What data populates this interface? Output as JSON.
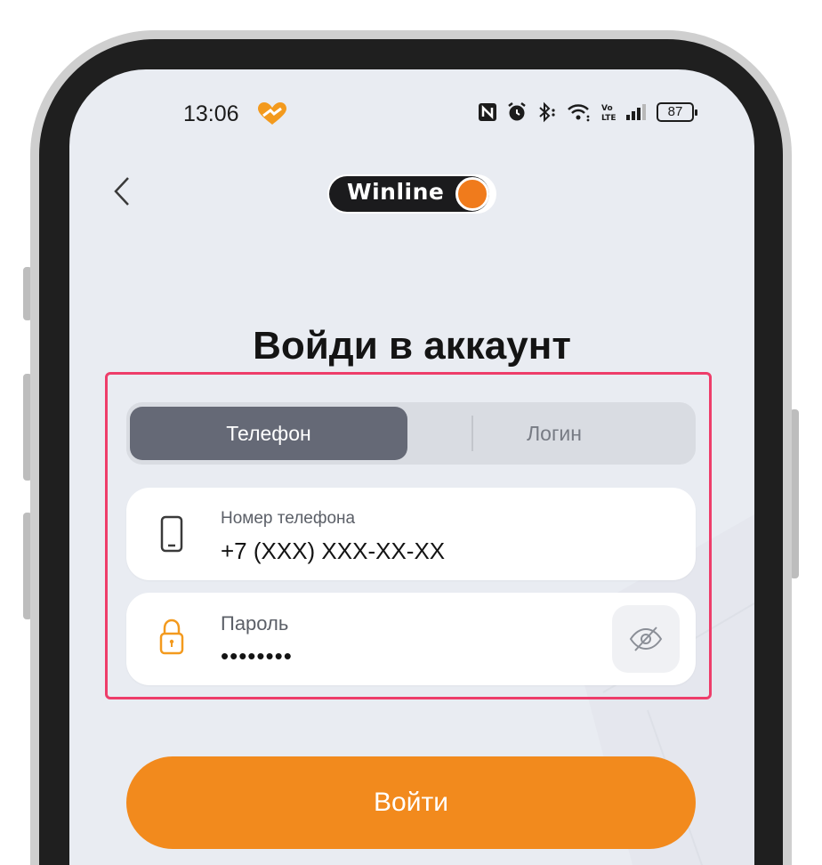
{
  "status_bar": {
    "time": "13:06",
    "battery": "87",
    "icons": [
      "heart-icon",
      "nfc-icon",
      "alarm-icon",
      "bluetooth-icon",
      "wifi-icon",
      "volte-icon",
      "signal-icon",
      "battery-icon"
    ]
  },
  "header": {
    "back_icon": "chevron-left-icon",
    "logo_text": "Winline"
  },
  "main": {
    "title": "Войди в аккаунт",
    "tabs": [
      {
        "label": "Телефон",
        "selected": true
      },
      {
        "label": "Логин",
        "selected": false
      }
    ],
    "phone_field": {
      "label": "Номер телефона",
      "value": "+7 (XXX) XXX-XX-XX",
      "icon": "smartphone-icon"
    },
    "password_field": {
      "label": "Пароль",
      "value": "••••••••",
      "icon": "lock-icon",
      "toggle_icon": "eye-off-icon"
    },
    "login_button": "Войти"
  },
  "colors": {
    "accent": "#f28a1d",
    "highlight": "#ee3d6a",
    "tab_active": "#656976",
    "screen_bg": "#e9ecf2"
  }
}
